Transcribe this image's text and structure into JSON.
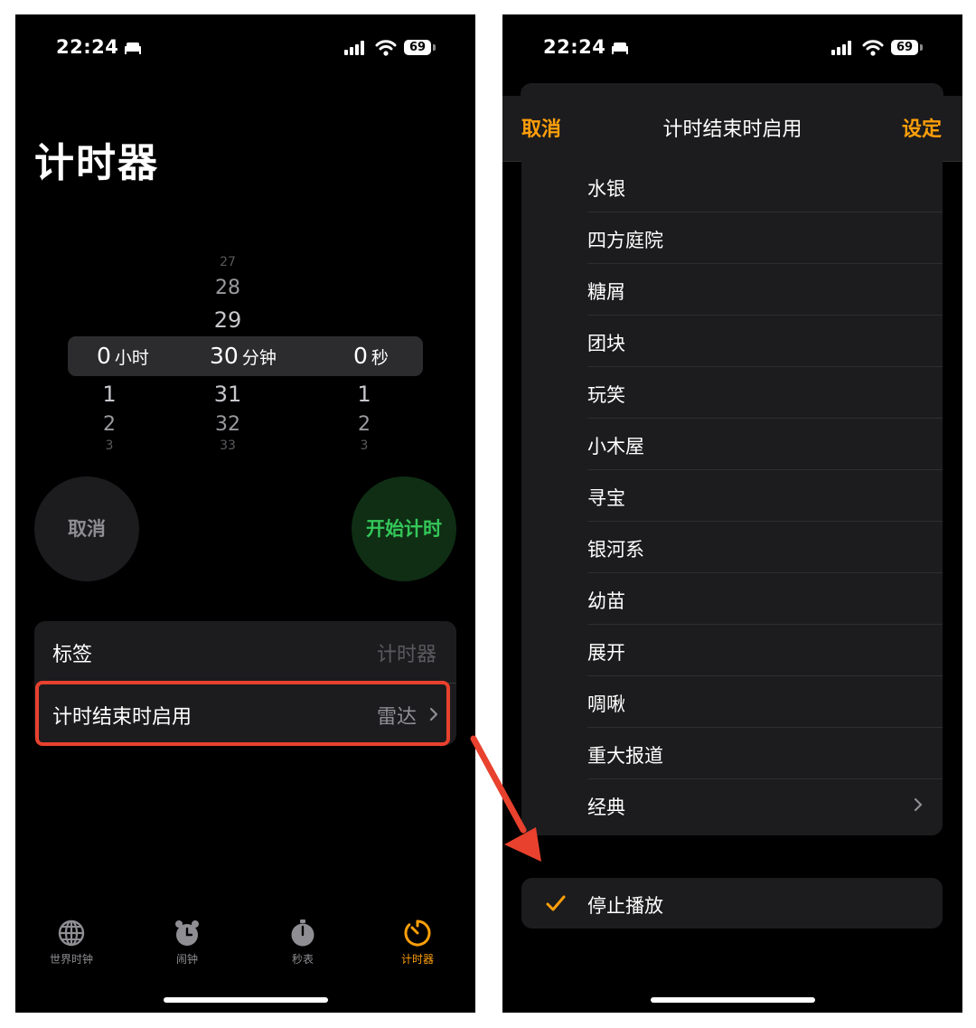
{
  "left_screen": {
    "status": {
      "time": "22:24",
      "battery": "69"
    },
    "title": "计时器",
    "picker": {
      "hours": {
        "above": [
          "",
          ""
        ],
        "selected": "0",
        "unit": "小时",
        "below": [
          "1",
          "2",
          "3"
        ]
      },
      "minutes": {
        "above": [
          "27",
          "28",
          "29"
        ],
        "selected": "30",
        "unit": "分钟",
        "below": [
          "31",
          "32",
          "33"
        ]
      },
      "seconds": {
        "above": [
          "",
          ""
        ],
        "selected": "0",
        "unit": "秒",
        "below": [
          "1",
          "2",
          "3"
        ]
      }
    },
    "cancel_label": "取消",
    "start_label": "开始计时",
    "settings": {
      "label_row": {
        "label": "标签",
        "value": "计时器"
      },
      "when_done_row": {
        "label": "计时结束时启用",
        "value": "雷达"
      }
    },
    "tabs": [
      {
        "label": "世界时钟",
        "icon": "globe-icon",
        "active": false
      },
      {
        "label": "闹钟",
        "icon": "alarm-icon",
        "active": false
      },
      {
        "label": "秒表",
        "icon": "stopwatch-icon",
        "active": false
      },
      {
        "label": "计时器",
        "icon": "timer-icon",
        "active": true
      }
    ]
  },
  "right_screen": {
    "status": {
      "time": "22:24",
      "battery": "69"
    },
    "header": {
      "cancel": "取消",
      "title": "计时结束时启用",
      "set": "设定"
    },
    "sounds": [
      "水银",
      "四方庭院",
      "糖屑",
      "团块",
      "玩笑",
      "小木屋",
      "寻宝",
      "银河系",
      "幼苗",
      "展开",
      "啁啾",
      "重大报道",
      "经典"
    ],
    "stop_playing": "停止播放"
  },
  "colors": {
    "accent": "#ff9f0a",
    "start_green": "#34c759",
    "highlight_red": "#e8412e"
  }
}
